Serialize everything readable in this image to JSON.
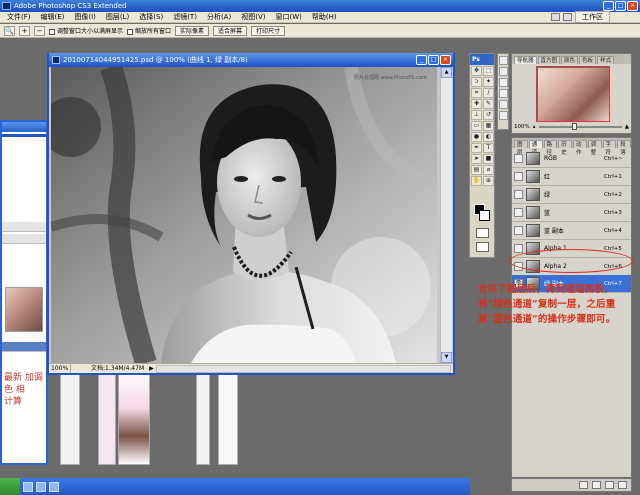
{
  "app": {
    "title": "Adobe Photoshop CS3 Extended"
  },
  "menu": [
    "文件(F)",
    "编辑(E)",
    "图像(I)",
    "图层(L)",
    "选择(S)",
    "滤镜(T)",
    "分析(A)",
    "视图(V)",
    "窗口(W)",
    "帮助(H)"
  ],
  "workspace": "工作区",
  "options": {
    "fit_window_label": "调整窗口大小以满屏显示",
    "zoom_all_label": "缩放所有窗口",
    "actual_pixels": "实际像素",
    "fit_screen": "适合屏幕",
    "print_size": "打印尺寸"
  },
  "document": {
    "title": "20100714044951425.psd @ 100% (曲线 1, 绿 副本/8)",
    "zoom": "100%",
    "status": "文档:1.34M/4.47M",
    "watermark": "照片处理网 www.PhotoPS.com"
  },
  "tools": {
    "header": "Ps"
  },
  "navigator": {
    "tabs": [
      "导航器",
      "直方图",
      "颜色",
      "色板",
      "样式"
    ],
    "zoom": "100%"
  },
  "channels": {
    "tabs": [
      "图层",
      "通道",
      "路径",
      "历史",
      "动作",
      "调整",
      "字符",
      "段落"
    ],
    "rows": [
      {
        "name": "RGB",
        "key": "Ctrl+~"
      },
      {
        "name": "红",
        "key": "Ctrl+1"
      },
      {
        "name": "绿",
        "key": "Ctrl+2"
      },
      {
        "name": "蓝",
        "key": "Ctrl+3"
      },
      {
        "name": "蓝 副本",
        "key": "Ctrl+4"
      },
      {
        "name": "Alpha 1",
        "key": "Ctrl+5"
      },
      {
        "name": "Alpha 2",
        "key": "Ctrl+6"
      },
      {
        "name": "绿 副本",
        "key": "Ctrl+7"
      }
    ]
  },
  "annotation": "合并了图层后，再到通道面板，将“绿色通道”复制一层，之后重复“蓝色通道”的操作步骤即可。",
  "left_window": {
    "scribble": "最新 加调\n色 相\n计算"
  }
}
